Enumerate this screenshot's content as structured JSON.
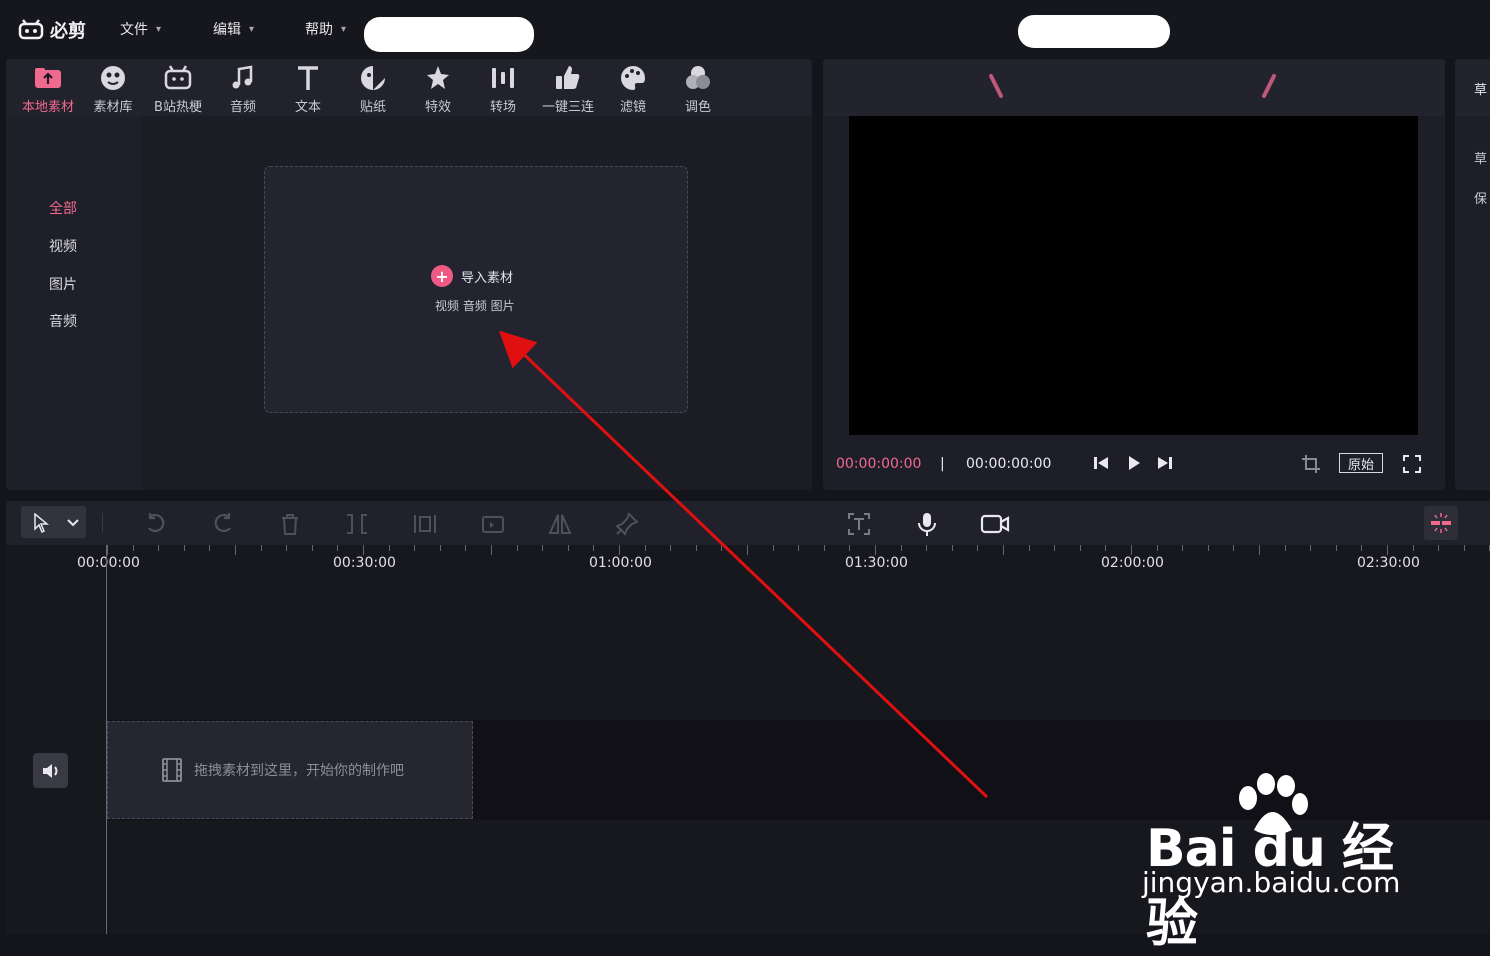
{
  "app": {
    "name": "必剪"
  },
  "menubar": {
    "items": [
      {
        "label": "文件"
      },
      {
        "label": "编辑"
      },
      {
        "label": "帮助"
      }
    ]
  },
  "toolbar": {
    "tools": [
      {
        "label": "本地素材",
        "icon": "upload-folder-icon",
        "active": true
      },
      {
        "label": "素材库",
        "icon": "material-library-icon"
      },
      {
        "label": "B站热梗",
        "icon": "bilibili-tv-icon"
      },
      {
        "label": "音频",
        "icon": "music-note-icon"
      },
      {
        "label": "文本",
        "icon": "text-t-icon"
      },
      {
        "label": "贴纸",
        "icon": "sticker-icon"
      },
      {
        "label": "特效",
        "icon": "star-effect-icon"
      },
      {
        "label": "转场",
        "icon": "transition-icon"
      },
      {
        "label": "一键三连",
        "icon": "thumbs-up-icon"
      },
      {
        "label": "滤镜",
        "icon": "palette-icon"
      },
      {
        "label": "调色",
        "icon": "color-adjust-icon"
      }
    ]
  },
  "sidebar": {
    "items": [
      {
        "label": "全部",
        "active": true
      },
      {
        "label": "视频"
      },
      {
        "label": "图片"
      },
      {
        "label": "音频"
      }
    ]
  },
  "dropzone": {
    "import_label": "导入素材",
    "sub_label": "视频 音频 图片"
  },
  "preview": {
    "current_time": "00:00:00:00",
    "separator": "|",
    "total_time": "00:00:00:00",
    "original_label": "原始"
  },
  "right_panel": {
    "items": [
      "草",
      "草",
      "保"
    ]
  },
  "timeline": {
    "ruler_labels": [
      "00:00:00",
      "00:30:00",
      "01:00:00",
      "01:30:00",
      "02:00:00",
      "02:30:00"
    ],
    "drop_hint": "拖拽素材到这里，开始你的制作吧"
  },
  "watermark": {
    "brand": "Bai du 经验",
    "url": "jingyan.baidu.com"
  },
  "colors": {
    "accent": "#f06a8f",
    "arrow": "#e01010"
  }
}
